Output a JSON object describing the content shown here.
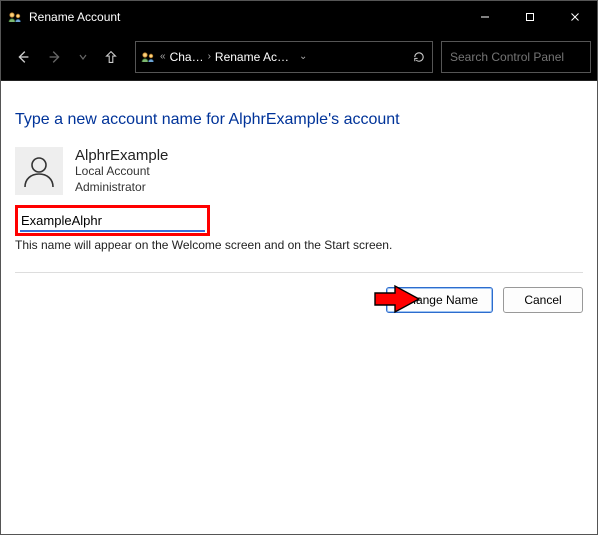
{
  "titlebar": {
    "title": "Rename Account"
  },
  "nav": {},
  "breadcrumb": {
    "first": "Cha…",
    "second": "Rename Ac…"
  },
  "search": {
    "placeholder": "Search Control Panel"
  },
  "heading": "Type a new account name for AlphrExample's account",
  "account": {
    "name": "AlphrExample",
    "type": "Local Account",
    "role": "Administrator"
  },
  "input": {
    "value": "ExampleAlphr"
  },
  "help_text": "This name will appear on the Welcome screen and on the Start screen.",
  "buttons": {
    "change": "Change Name",
    "cancel": "Cancel"
  }
}
